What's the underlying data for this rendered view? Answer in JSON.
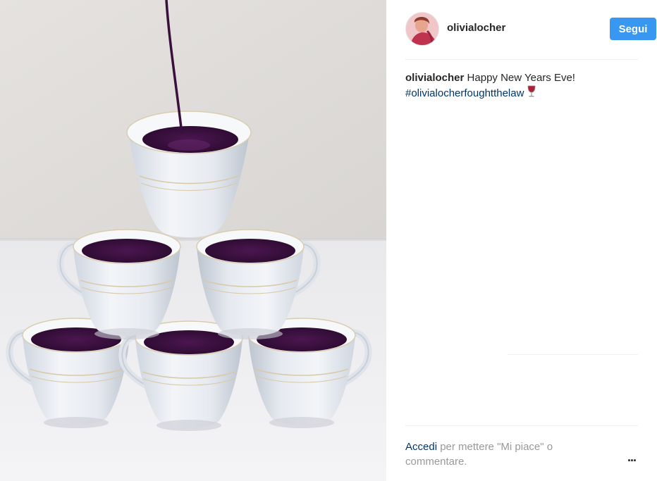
{
  "post": {
    "username": "olivialocher",
    "follow_label": "Segui",
    "caption": {
      "username": "olivialocher",
      "text": "Happy New Years Eve!",
      "hashtag": "#olivialocherfoughtthelaw",
      "emoji_icon": "wine-glass-icon"
    },
    "footer": {
      "login_link": "Accedi",
      "login_prompt": "per mettere \"Mi piace\" o commentare.",
      "more_label": "..."
    }
  },
  "colors": {
    "follow_button_bg": "#3897f0",
    "hashtag_link": "#003569",
    "wine": "#3a0f3e"
  }
}
